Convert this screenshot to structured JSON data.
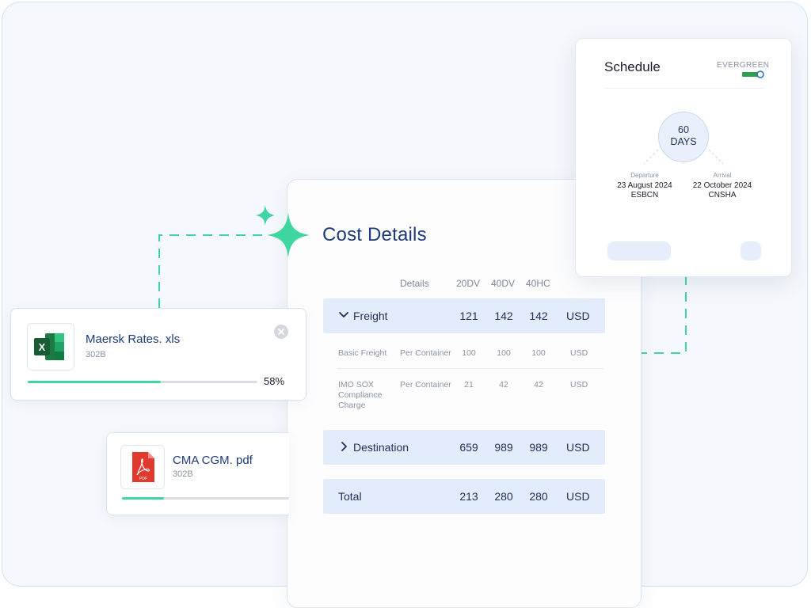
{
  "cost": {
    "title": "Cost Details",
    "columns": [
      "Details",
      "20DV",
      "40DV",
      "40HC"
    ],
    "freight": {
      "label": "Freight",
      "v20": "121",
      "v40": "142",
      "v40hc": "142",
      "currency": "USD"
    },
    "rows": [
      {
        "name": "Basic Freight",
        "basis": "Per Container",
        "v20": "100",
        "v40": "100",
        "v40hc": "100",
        "currency": "USD"
      },
      {
        "name_lines": [
          "IMO SOX",
          "Compliance",
          "Charge"
        ],
        "basis": "Per Container",
        "v20": "21",
        "v40": "42",
        "v40hc": "42",
        "currency": "USD"
      }
    ],
    "destination": {
      "label": "Destination",
      "v20": "659",
      "v40": "989",
      "v40hc": "989",
      "currency": "USD"
    },
    "total": {
      "label": "Total",
      "v20": "213",
      "v40": "280",
      "v40hc": "280",
      "currency": "USD"
    }
  },
  "schedule": {
    "title": "Schedule",
    "carrier": "EVERGREEN",
    "transit": {
      "value": "60",
      "unit": "DAYS"
    },
    "departure": {
      "label": "Departure",
      "date": "23 August 2024",
      "port": "ESBCN"
    },
    "arrival": {
      "label": "Arrival",
      "date": "22 October 2024",
      "port": "CNSHA"
    }
  },
  "files": [
    {
      "name": "Maersk Rates. xls",
      "size": "302B",
      "progress_pct": 58,
      "progress_label": "58%",
      "icon": "excel-icon"
    },
    {
      "name": "CMA CGM. pdf",
      "size": "302B",
      "progress_pct": 25,
      "icon": "pdf-icon"
    }
  ],
  "colors": {
    "accent_green": "#3fd6a0",
    "title_blue": "#1e3a7a",
    "band_blue": "#e3ecfb",
    "excel_green": "#1d7a43",
    "pdf_red": "#e03a2f"
  }
}
